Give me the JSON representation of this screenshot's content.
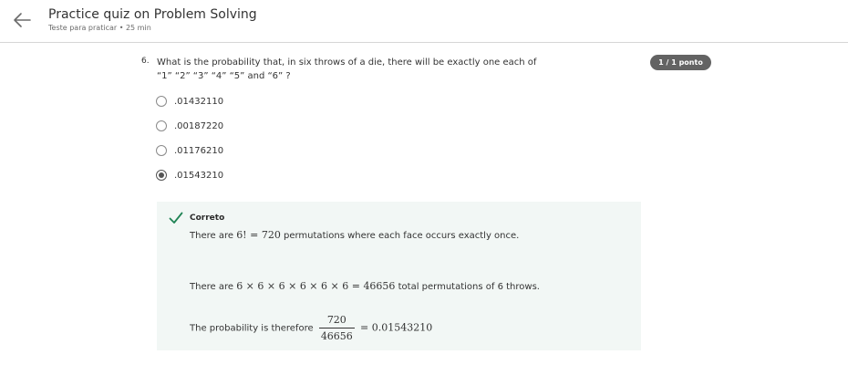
{
  "header": {
    "title": "Practice quiz on Problem Solving",
    "subtitle": "Teste para praticar • 25 min"
  },
  "question": {
    "number": "6.",
    "text": "What is the probability that, in six throws of a die, there will be exactly one each of “1” “2” “3” “4” “5” and “6” ?",
    "score": "1 / 1 ponto",
    "options": [
      {
        "label": ".01432110",
        "selected": false
      },
      {
        "label": ".00187220",
        "selected": false
      },
      {
        "label": ".01176210",
        "selected": false
      },
      {
        "label": ".01543210",
        "selected": true
      }
    ]
  },
  "feedback": {
    "status": "Correto",
    "line1_prefix": "There are",
    "line1_math": "6! = 720",
    "line1_suffix": "permutations where each face occurs exactly once.",
    "line2_prefix": "There are",
    "line2_math": "6 × 6 × 6 × 6 × 6 × 6 = 46656",
    "line2_suffix": "total permutations of 6 throws.",
    "line3_prefix": "The probability is therefore",
    "line3_num": "720",
    "line3_den": "46656",
    "line3_result": "= 0.01543210"
  },
  "colors": {
    "badge": "#636363",
    "feedback_bg": "#f2f7f5",
    "check": "#1f8354"
  },
  "icons": {
    "back": "arrow-left-icon",
    "correct": "checkmark-icon"
  }
}
